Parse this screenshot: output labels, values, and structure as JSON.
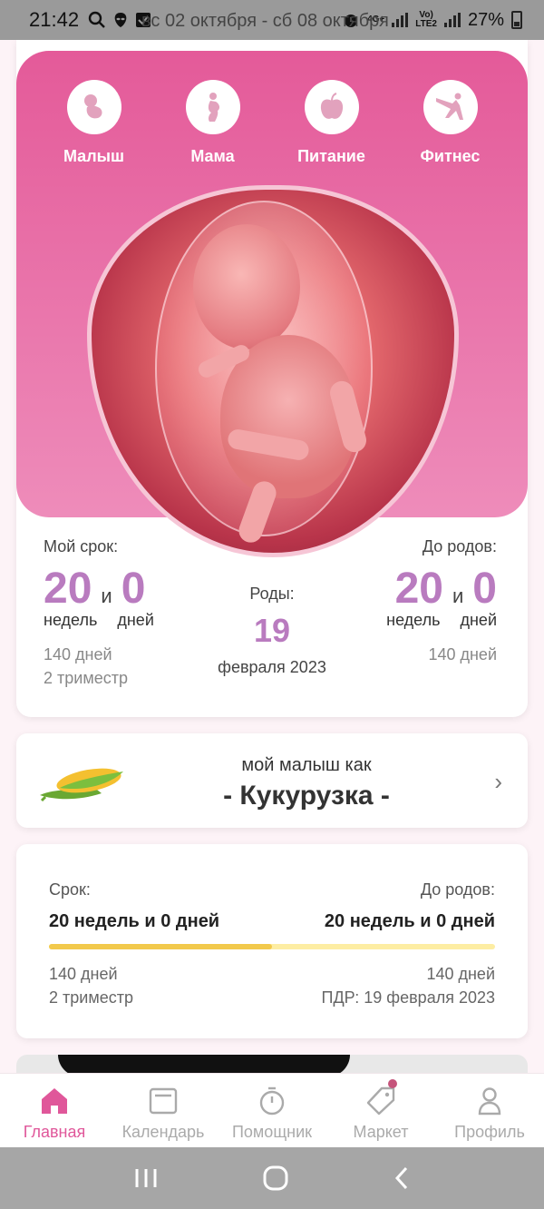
{
  "status_bar": {
    "time": "21:42",
    "overlay_text": "вс 02 октября - сб 08 октября",
    "net_top": "4G+",
    "volte_top": "Vo)",
    "volte_bottom": "LTE2",
    "battery": "27%"
  },
  "categories": [
    {
      "label": "Малыш",
      "icon": "baby-icon"
    },
    {
      "label": "Мама",
      "icon": "pregnant-mother-icon"
    },
    {
      "label": "Питание",
      "icon": "apple-icon"
    },
    {
      "label": "Фитнес",
      "icon": "fitness-icon"
    }
  ],
  "term": {
    "my_term_label": "Мой срок:",
    "weeks": "20",
    "and": "и",
    "days": "0",
    "weeks_unit": "недель",
    "days_unit": "дней",
    "total_days": "140 дней",
    "trimester": "2 триместр",
    "birth_label": "Роды:",
    "birth_day": "19",
    "birth_month_year": "февраля 2023",
    "until_label": "До родов:",
    "until_weeks": "20",
    "until_days": "0",
    "until_total_days": "140 дней"
  },
  "compare": {
    "subtitle": "мой малыш как",
    "title": "- Кукурузка -",
    "chevron": "›"
  },
  "progress_card": {
    "left_label": "Срок:",
    "right_label": "До родов:",
    "left_value": "20 недель и 0 дней",
    "right_value": "20 недель и 0 дней",
    "progress_fraction": 0.5,
    "left_days": "140 дней",
    "left_trimester": "2 триместр",
    "right_days": "140 дней",
    "due_date": "ПДР: 19 февраля 2023"
  },
  "bottom_nav": [
    {
      "label": "Главная",
      "icon": "home-icon",
      "active": true
    },
    {
      "label": "Календарь",
      "icon": "calendar-icon",
      "active": false
    },
    {
      "label": "Помощник",
      "icon": "stopwatch-icon",
      "active": false
    },
    {
      "label": "Маркет",
      "icon": "tag-icon",
      "active": false
    },
    {
      "label": "Профиль",
      "icon": "profile-icon",
      "active": false
    }
  ],
  "colors": {
    "accent_pink": "#e0579a",
    "number_purple": "#b97bbf",
    "progress_fill": "#f2c94c",
    "progress_track": "#fdeda3"
  }
}
